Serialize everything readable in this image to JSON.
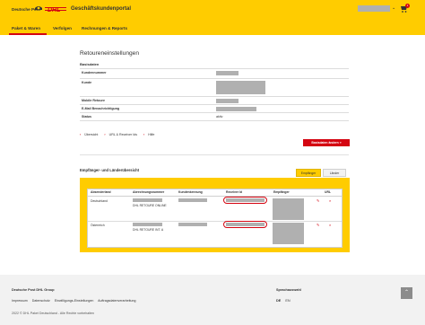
{
  "header": {
    "brand": "Deutsche Post",
    "logo_text": "DHL",
    "portal_title": "Geschäftskundenportal",
    "cart_count": "1",
    "colors": {
      "yellow": "#ffcc00",
      "red": "#d40511"
    }
  },
  "nav": {
    "items": [
      {
        "label": "Paket & Waren"
      },
      {
        "label": "Verfolgen"
      },
      {
        "label": "Rechnungen & Reports"
      }
    ]
  },
  "main": {
    "title": "Retoureneinstellungen",
    "basisdaten_title": "Basisdaten",
    "fields": [
      {
        "label": "Kundennummer"
      },
      {
        "label": "Kunde"
      },
      {
        "label": "Mobile Retoure"
      },
      {
        "label": "E-Mail Benachrichtigung"
      },
      {
        "label": "Status",
        "value": "aktiv"
      }
    ],
    "links": [
      "Übersicht",
      "URL & Receiver Ids",
      "Hilfe"
    ],
    "change_button": "Basisdaten ändern",
    "overview_title": "Empfänger- und Länderübersicht",
    "tabs": [
      "Empfänger",
      "Länder"
    ],
    "table": {
      "headers": [
        "Absenderland",
        "Abrechnungsnummer",
        "Kundenkennung",
        "Receiver Id",
        "Empfänger",
        "URL"
      ],
      "rows": [
        {
          "country": "Deutschland",
          "billing_label": "DHL RETOURE ONLINE"
        },
        {
          "country": "Österreich",
          "billing_label": "DHL RETOURE INT. A"
        }
      ]
    }
  },
  "footer": {
    "group": "Deutsche Post DHL Group",
    "links": [
      "Impressum",
      "Datenschutz",
      "Einwilligungs-Einstellungen",
      "Auftragsdatenverarbeitung"
    ],
    "language_title": "Sprachauswahl",
    "languages": [
      "DE",
      "EN"
    ],
    "copyright": "2022 © DHL Paket Deutschland - Alle Rechte vorbehalten"
  }
}
